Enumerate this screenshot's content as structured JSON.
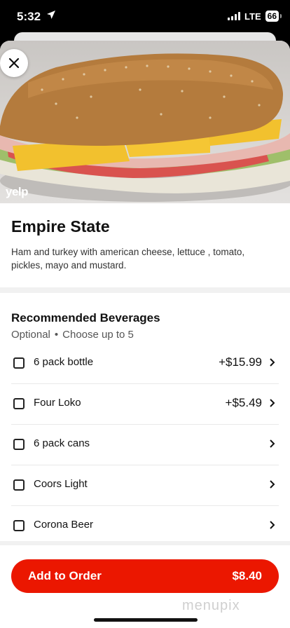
{
  "status_bar": {
    "time": "5:32",
    "network": "LTE",
    "battery": "66"
  },
  "item": {
    "name": "Empire State",
    "description": "Ham and turkey with american cheese, lettuce , tomato, pickles, mayo and mustard.",
    "image_credit": "yelp"
  },
  "section": {
    "title": "Recommended Beverages",
    "optional": "Optional",
    "choose": "Choose up to 5"
  },
  "options": [
    {
      "label": "6 pack bottle",
      "price": "+$15.99"
    },
    {
      "label": "Four Loko",
      "price": "+$5.49"
    },
    {
      "label": "6 pack cans",
      "price": ""
    },
    {
      "label": "Coors Light",
      "price": ""
    },
    {
      "label": "Corona Beer",
      "price": ""
    }
  ],
  "order": {
    "label": "Add to Order",
    "price": "$8.40"
  },
  "watermark": "menupix",
  "colors": {
    "accent": "#eb1700"
  }
}
